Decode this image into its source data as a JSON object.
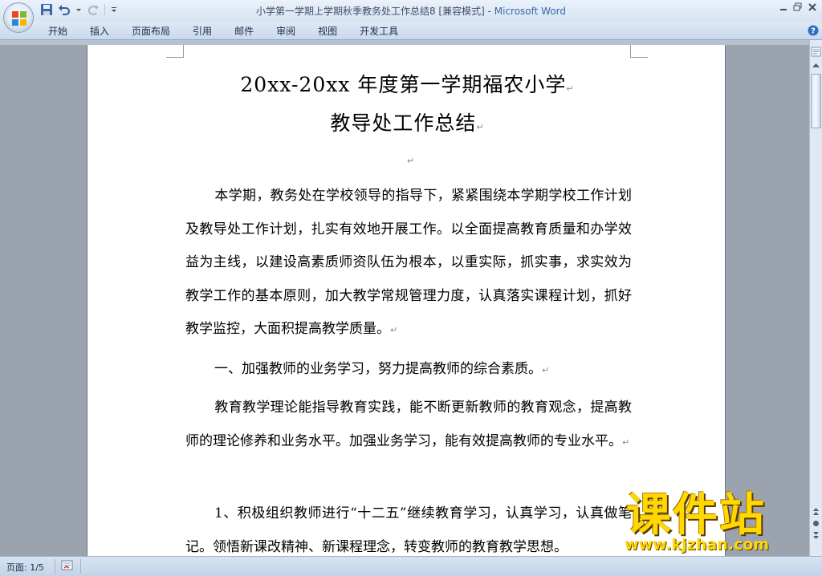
{
  "window": {
    "title_doc": "小学第一学期上学期秋季教务处工作总结8 [兼容模式]",
    "title_sep": " - ",
    "title_app": "Microsoft Word"
  },
  "quick_access": {
    "icons": [
      "save-icon",
      "undo-icon",
      "redo-icon",
      "customize-icon"
    ]
  },
  "ribbon": {
    "tabs": [
      "开始",
      "插入",
      "页面布局",
      "引用",
      "邮件",
      "审阅",
      "视图",
      "开发工具"
    ]
  },
  "document": {
    "title_line1": "20xx-20xx 年度第一学期福农小学",
    "title_line2": "教导处工作总结",
    "paragraph_mark": "↵",
    "paragraphs": [
      "本学期，教务处在学校领导的指导下，紧紧围绕本学期学校工作计划及教导处工作计划，扎实有效地开展工作。以全面提高教育质量和办学效益为主线，以建设高素质师资队伍为根本，以重实际，抓实事，求实效为教学工作的基本原则，加大教学常规管理力度，认真落实课程计划，抓好教学监控，大面积提高教学质量。",
      "一、加强教师的业务学习，努力提高教师的综合素质。",
      "教育教学理论能指导教育实践，能不断更新教师的教育观念，提高教师的理论修养和业务水平。加强业务学习，能有效提高教师的专业水平。",
      "1、积极组织教师进行“十二五”继续教育学习，认真学习，认真做笔记。领悟新课改精神、新课程理念，转变教师的教育教学思想。"
    ]
  },
  "statusbar": {
    "page_info": "页面: 1/5"
  },
  "watermark": {
    "text_cn": "课件站",
    "text_url": "www.kjzhan.com"
  },
  "colors": {
    "title_app": "#3a67a8",
    "watermark": "#ffd800",
    "workspace": "#9ba3ae"
  }
}
